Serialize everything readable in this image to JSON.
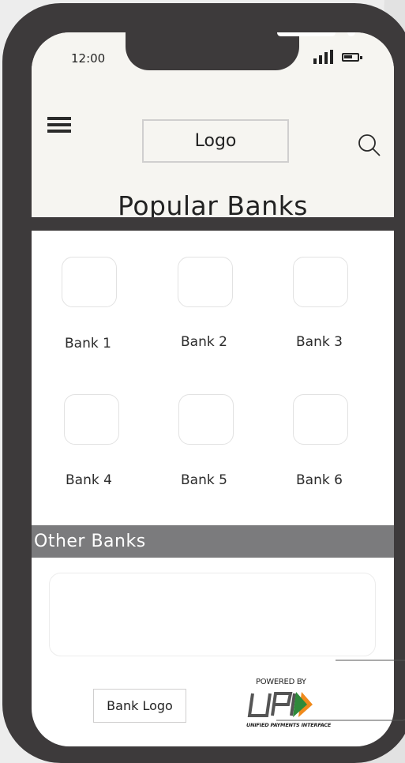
{
  "status_bar": {
    "time": "12:00"
  },
  "header": {
    "logo_text": "Logo",
    "title": "Popular Banks"
  },
  "popular_banks": [
    {
      "label": "Bank 1"
    },
    {
      "label": "Bank 2"
    },
    {
      "label": "Bank 3"
    },
    {
      "label": "Bank 4"
    },
    {
      "label": "Bank 5"
    },
    {
      "label": "Bank 6"
    }
  ],
  "other_banks": {
    "heading": "Other Banks"
  },
  "footer": {
    "bank_logo_text": "Bank Logo",
    "upi_powered_by": "POWERED BY",
    "upi_tagline": "UNIFIED PAYMENTS INTERFACE"
  },
  "colors": {
    "phone_frame": "#3d3a3b",
    "header_bg": "#f6f5f1",
    "section_bar": "#7b7b7d",
    "upi_green": "#2e8a3a",
    "upi_orange": "#f08a1c"
  },
  "icons": [
    "hamburger-menu-icon",
    "search-icon",
    "signal-icon",
    "battery-icon",
    "upi-logo"
  ]
}
